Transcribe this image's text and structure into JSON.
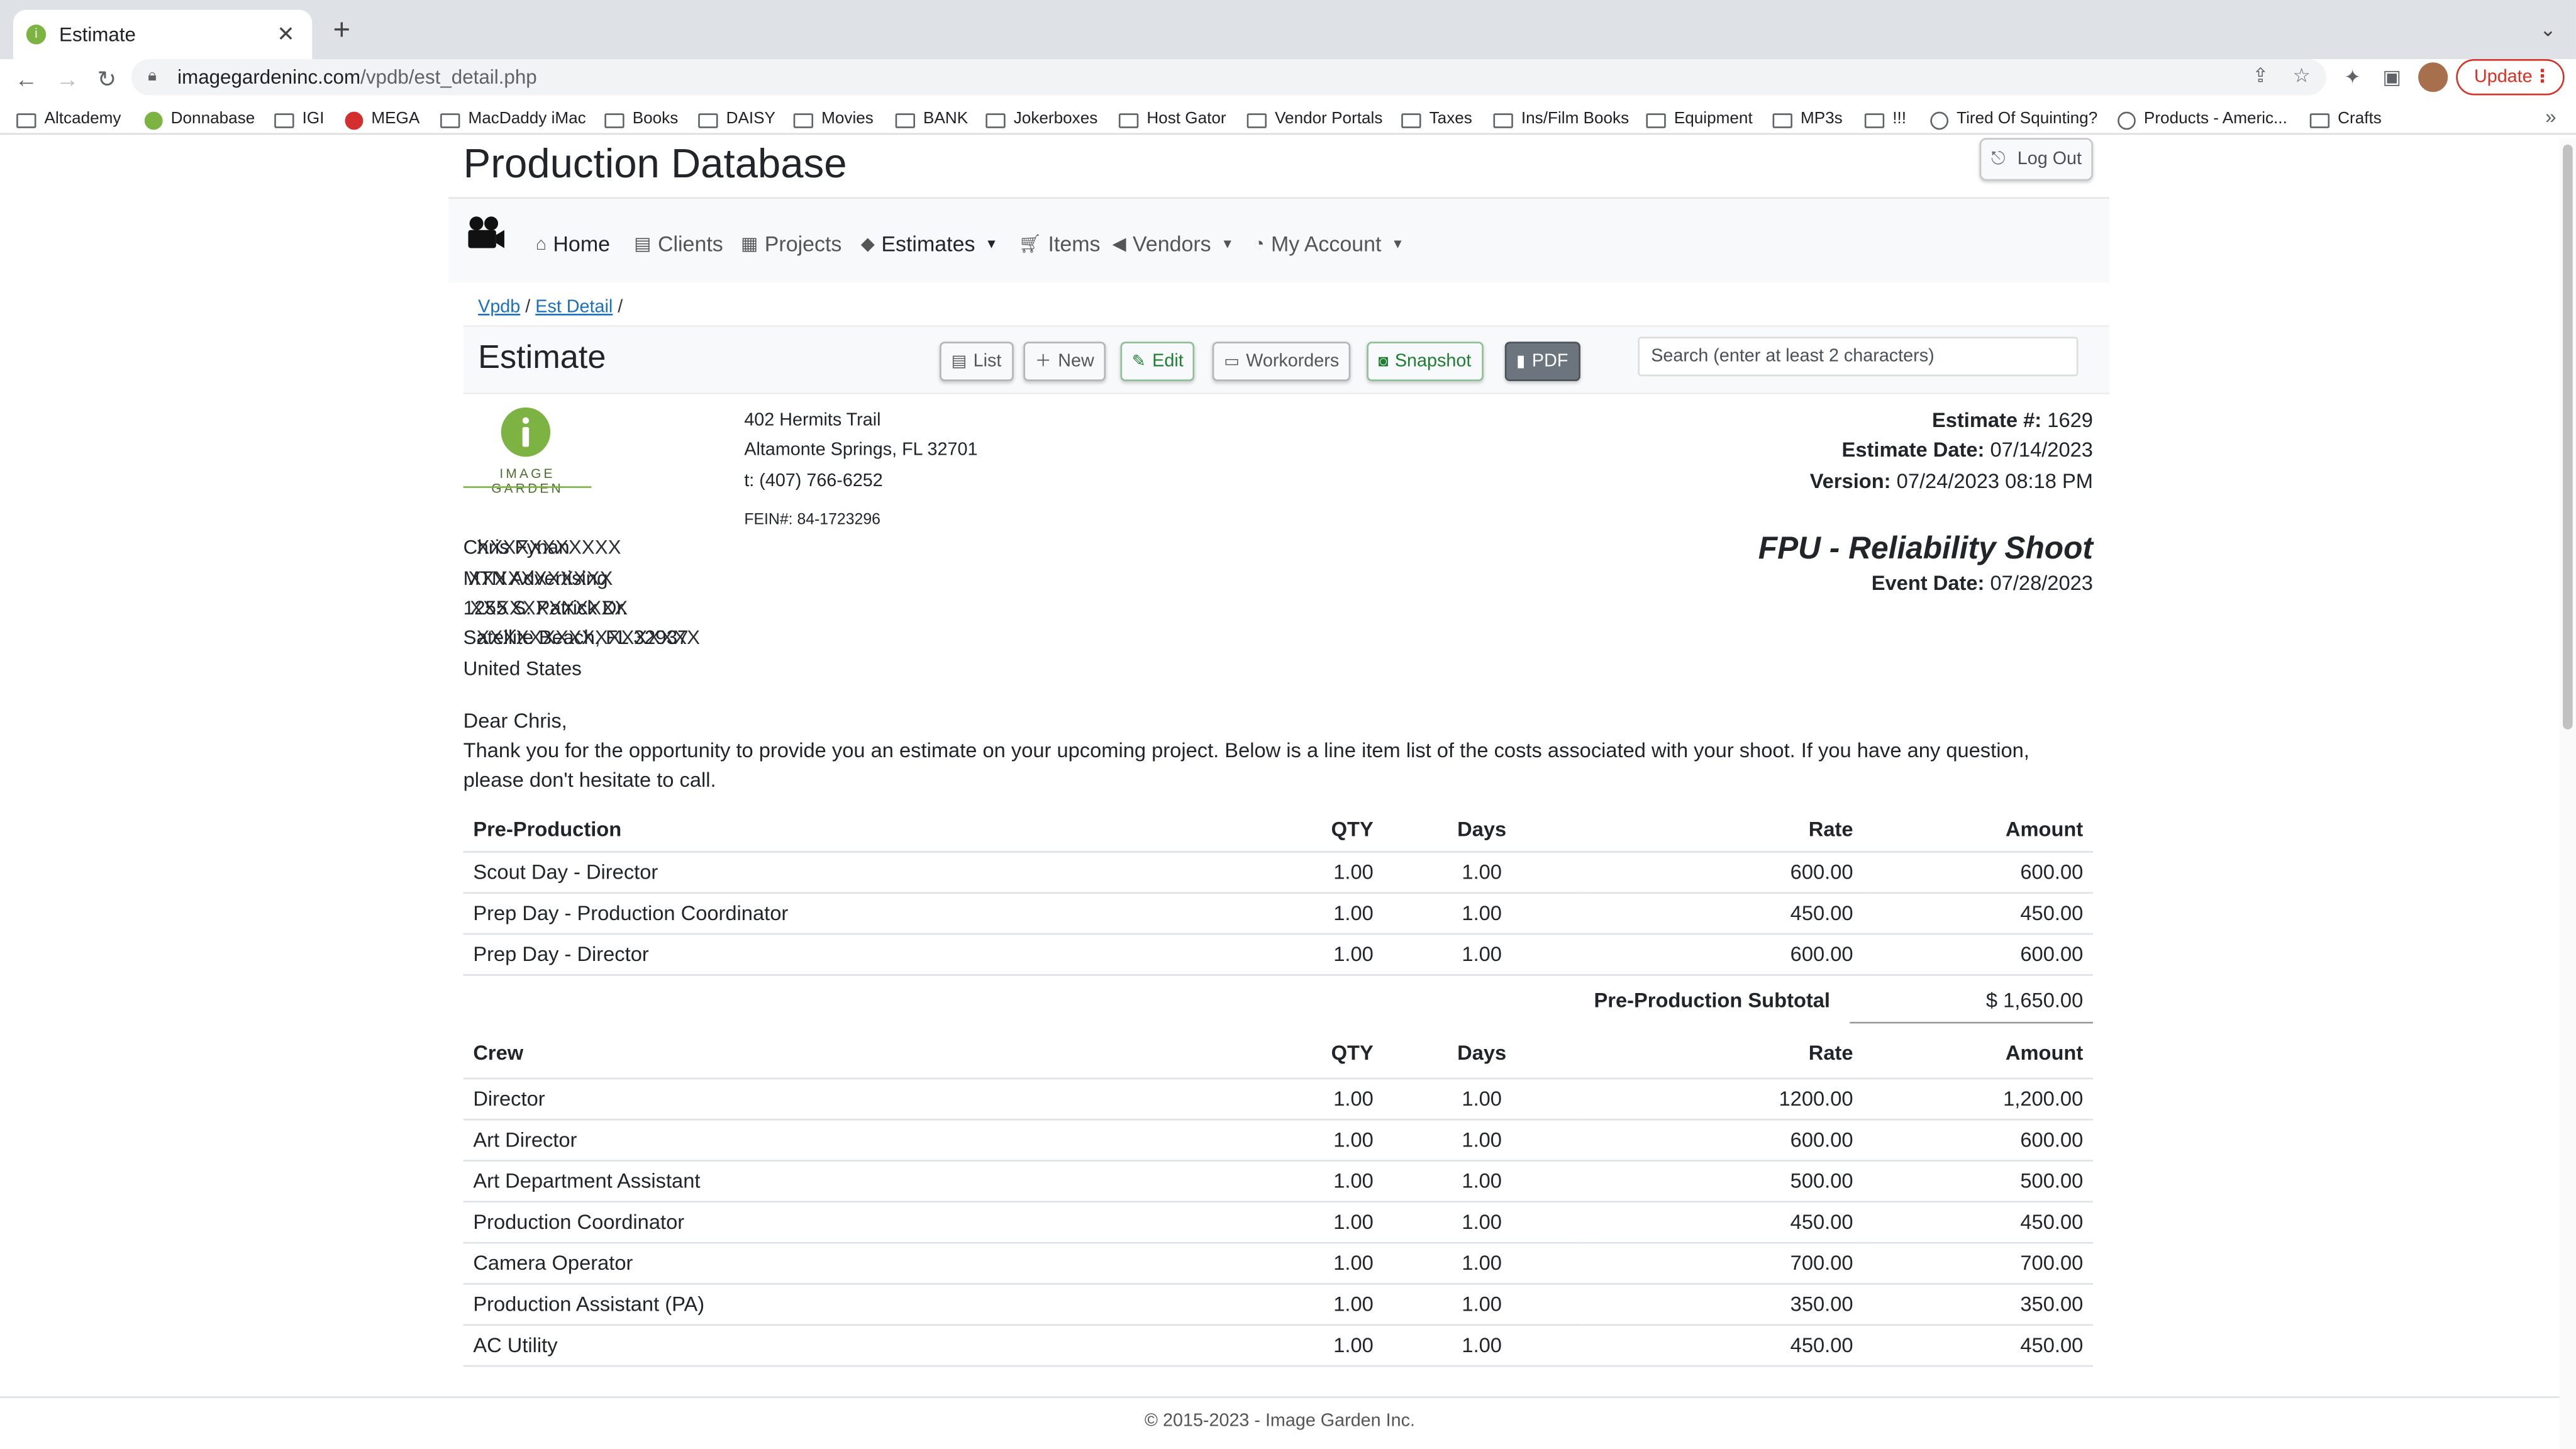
{
  "browser": {
    "tab_title": "Estimate",
    "url_host": "imagegardeninc.com",
    "url_path": "/vpdb/est_detail.php",
    "update_label": "Update",
    "bookmarks": [
      "Altcademy",
      "Donnabase",
      "IGI",
      "MEGA",
      "MacDaddy iMac",
      "Books",
      "DAISY",
      "Movies",
      "BANK",
      "Jokerboxes",
      "Host Gator",
      "Vendor Portals",
      "Taxes",
      "Ins/Film Books",
      "Equipment",
      "MP3s",
      "!!!",
      "Tired Of Squinting?",
      "Products - Americ...",
      "Crafts"
    ]
  },
  "app": {
    "title": "Production Database",
    "logout_label": "Log Out",
    "nav": {
      "home": "Home",
      "clients": "Clients",
      "projects": "Projects",
      "estimates": "Estimates",
      "items": "Items",
      "vendors": "Vendors",
      "my_account": "My Account"
    },
    "breadcrumb": {
      "root": "Vpdb",
      "current": "Est Detail",
      "sep": "/"
    }
  },
  "toolbar": {
    "section_title": "Estimate",
    "list": "List",
    "new": "New",
    "edit": "Edit",
    "workorders": "Workorders",
    "snapshot": "Snapshot",
    "pdf": "PDF",
    "search_placeholder": "Search (enter at least 2 characters)"
  },
  "company": {
    "logo_text": "IMAGE GARDEN",
    "address1": "402 Hermits Trail",
    "address2": "Altamonte Springs, FL  32701",
    "phone": "t: (407) 766-6252",
    "fein": "FEIN#: 84-1723296"
  },
  "estimate": {
    "number_label": "Estimate #:",
    "number": "1629",
    "date_label": "Estimate Date:",
    "date": "07/14/2023",
    "version_label": "Version:",
    "version": "07/24/2023 08:18 PM",
    "project_title": "FPU - Reliability Shoot",
    "event_date_label": "Event Date:",
    "event_date": "07/28/2023"
  },
  "client": {
    "line1_a": "Chris Fynan",
    "line1_b": "XXXXXXXXXXX",
    "line2_a": "MTN Advertising",
    "line2_b": "XXXXXXXXXXX",
    "line3_a": "1255 S. Patrick Dr.",
    "line3_b": "XXXXXXXXXXXX",
    "line4_a": "Satellite Beach, FL 32937",
    "line4_b": "XXXXXXXXXXXXXXXXX",
    "country": "United States"
  },
  "letter": {
    "greeting": "Dear Chris,",
    "body": "Thank you for the opportunity to provide you an estimate on your upcoming project. Below is a line item list of the costs associated with your shoot. If you have any question, please don't hesitate to call."
  },
  "columns": {
    "qty": "QTY",
    "days": "Days",
    "rate": "Rate",
    "amount": "Amount"
  },
  "preproduction": {
    "heading": "Pre-Production",
    "rows": [
      {
        "name": "Scout Day - Director",
        "qty": "1.00",
        "days": "1.00",
        "rate": "600.00",
        "amount": "600.00"
      },
      {
        "name": "Prep Day - Production Coordinator",
        "qty": "1.00",
        "days": "1.00",
        "rate": "450.00",
        "amount": "450.00"
      },
      {
        "name": "Prep Day - Director",
        "qty": "1.00",
        "days": "1.00",
        "rate": "600.00",
        "amount": "600.00"
      }
    ],
    "subtotal_label": "Pre-Production Subtotal",
    "subtotal": "$ 1,650.00"
  },
  "crew": {
    "heading": "Crew",
    "rows": [
      {
        "name": "Director",
        "qty": "1.00",
        "days": "1.00",
        "rate": "1200.00",
        "amount": "1,200.00"
      },
      {
        "name": "Art Director",
        "qty": "1.00",
        "days": "1.00",
        "rate": "600.00",
        "amount": "600.00"
      },
      {
        "name": "Art Department Assistant",
        "qty": "1.00",
        "days": "1.00",
        "rate": "500.00",
        "amount": "500.00"
      },
      {
        "name": "Production Coordinator",
        "qty": "1.00",
        "days": "1.00",
        "rate": "450.00",
        "amount": "450.00"
      },
      {
        "name": "Camera Operator",
        "qty": "1.00",
        "days": "1.00",
        "rate": "700.00",
        "amount": "700.00"
      },
      {
        "name": "Production Assistant (PA)",
        "qty": "1.00",
        "days": "1.00",
        "rate": "350.00",
        "amount": "350.00"
      },
      {
        "name": "AC Utility",
        "qty": "1.00",
        "days": "1.00",
        "rate": "450.00",
        "amount": "450.00"
      }
    ]
  },
  "footer": {
    "text": "© 2015-2023 - Image Garden Inc."
  }
}
